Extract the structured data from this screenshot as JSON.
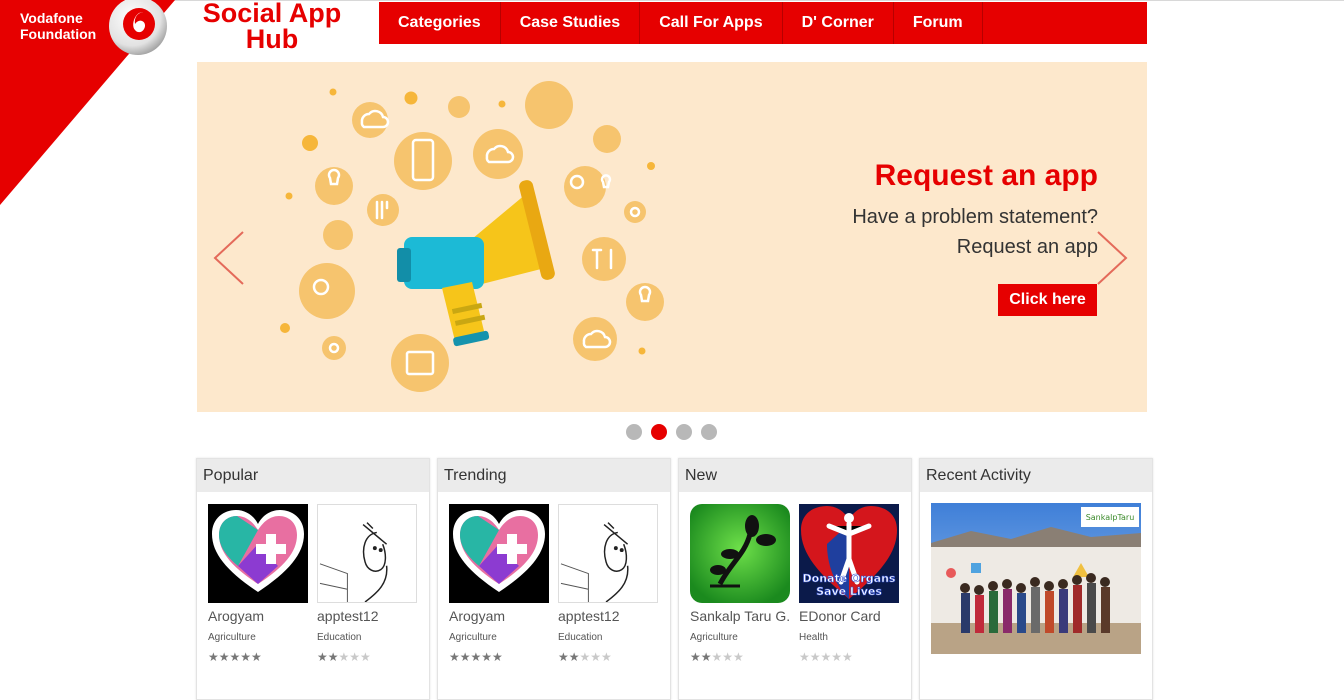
{
  "brand": {
    "line1": "Vodafone",
    "line2": "Foundation",
    "title_line1": "Social App",
    "title_line2": "Hub"
  },
  "nav": {
    "items": [
      "Categories",
      "Case Studies",
      "Call For Apps",
      "D' Corner",
      "Forum"
    ]
  },
  "hero": {
    "title": "Request an app",
    "subtitle_line1": "Have a problem statement?",
    "subtitle_line2": "Request an app",
    "button": "Click here",
    "active_slide": 2,
    "slide_count": 4
  },
  "panels": {
    "popular": {
      "title": "Popular",
      "apps": [
        {
          "name": "Arogyam",
          "category": "Agriculture",
          "rating": 5
        },
        {
          "name": "apptest12",
          "category": "Education",
          "rating": 2
        }
      ]
    },
    "trending": {
      "title": "Trending",
      "apps": [
        {
          "name": "Arogyam",
          "category": "Agriculture",
          "rating": 5
        },
        {
          "name": "apptest12",
          "category": "Education",
          "rating": 2
        }
      ]
    },
    "new": {
      "title": "New",
      "apps": [
        {
          "name": "Sankalp Taru G...",
          "category": "Agriculture",
          "rating": 2
        },
        {
          "name": "EDonor Card",
          "category": "Health",
          "rating": 0
        }
      ]
    },
    "recent": {
      "title": "Recent Activity",
      "image_caption": "SankalpTaru"
    }
  },
  "edonor_image_text": {
    "line1": "Donate Organs",
    "line2": "Save Lives"
  },
  "colors": {
    "brand_red": "#e60000",
    "hero_bg": "#fde8cc",
    "illustration_orange": "#f6c46e",
    "megaphone_blue": "#1cbad6",
    "megaphone_yellow": "#f6c51a"
  }
}
